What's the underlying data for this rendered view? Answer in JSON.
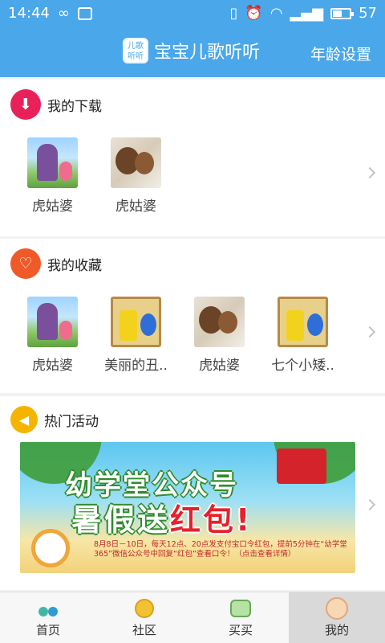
{
  "status": {
    "time": "14:44",
    "battery": "57",
    "battery_level": 0.57
  },
  "header": {
    "logo_text_top": "儿歌",
    "logo_text_bottom": "听听",
    "title": "宝宝儿歌听听",
    "age_setting": "年龄设置"
  },
  "download": {
    "title": "我的下载",
    "items": [
      {
        "label": "虎姑婆",
        "thumb": "grandma"
      },
      {
        "label": "虎姑婆",
        "thumb": "bear"
      }
    ]
  },
  "favorites": {
    "title": "我的收藏",
    "items": [
      {
        "label": "虎姑婆",
        "thumb": "grandma"
      },
      {
        "label": "美丽的丑..",
        "thumb": "ugly"
      },
      {
        "label": "虎姑婆",
        "thumb": "bear"
      },
      {
        "label": "七个小矮..",
        "thumb": "ugly"
      }
    ]
  },
  "events": {
    "title": "热门活动",
    "banner": {
      "line1": "幼学堂公众号",
      "line2_a": "暑假送",
      "line2_b": "红包!",
      "detail": "8月8日－10日，每天12点、20点发支付宝口令红包，提前5分钟在“幼学堂365”微信公众号中回复“红包”查看口令！（点击查看详情）"
    }
  },
  "tabs": [
    {
      "label": "首页",
      "icon": "music-note-icon"
    },
    {
      "label": "社区",
      "icon": "community-icon"
    },
    {
      "label": "买买",
      "icon": "shopping-icon"
    },
    {
      "label": "我的",
      "icon": "baby-face-icon",
      "active": true
    }
  ],
  "colors": {
    "accent": "#4aa7ea",
    "download_icon": "#e8215a",
    "favorite_icon": "#f05a28",
    "event_icon": "#f5b400"
  }
}
